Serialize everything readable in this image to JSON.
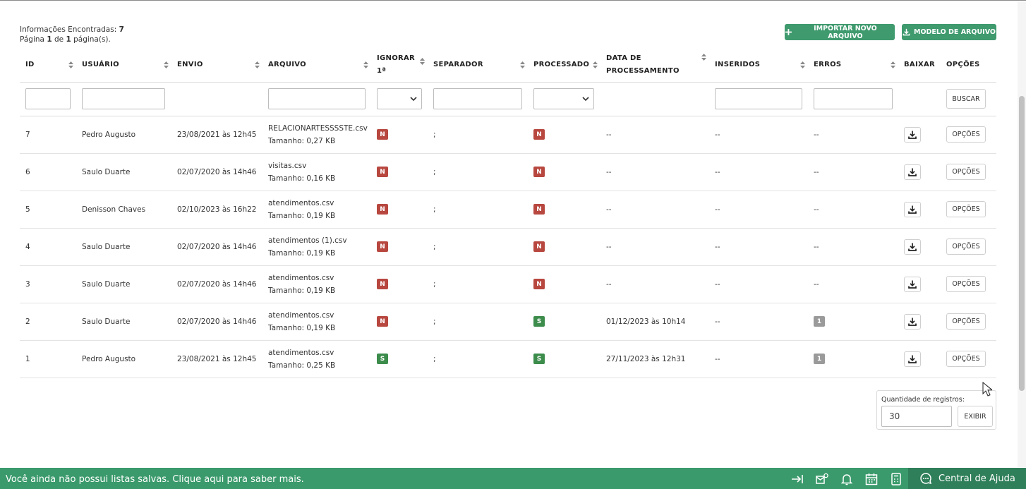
{
  "summary": {
    "found_label": "Informações Encontradas:",
    "found_count": "7",
    "page_prefix": "Página",
    "page_current": "1",
    "page_of": "de",
    "page_total": "1",
    "page_suffix": "página(s)."
  },
  "toolbar": {
    "import_label": "IMPORTAR NOVO ARQUIVO",
    "template_label": "MODELO DE ARQUIVO"
  },
  "columns": {
    "id": "ID",
    "usuario": "USUÁRIO",
    "envio": "ENVIO",
    "arquivo": "ARQUIVO",
    "ignorar_1": "IGNORAR",
    "ignorar_2": "1ª",
    "separador": "SEPARADOR",
    "processado": "PROCESSADO",
    "data_1": "DATA DE",
    "data_2": "PROCESSAMENTO",
    "inseridos": "INSERIDOS",
    "erros": "ERROS",
    "baixar": "BAIXAR",
    "opcoes": "OPÇÕES"
  },
  "filters": {
    "search_label": "BUSCAR"
  },
  "row_option_label": "OPÇÕES",
  "rows": [
    {
      "id": "7",
      "user": "Pedro Augusto",
      "sent": "23/08/2021 às 12h45",
      "file": "RELACIONARTESSSSTE.csv",
      "size": "Tamanho: 0,27 KB",
      "ignore": "N",
      "sep": ";",
      "processed": "N",
      "date": "--",
      "inserted": "--",
      "errors": "--"
    },
    {
      "id": "6",
      "user": "Saulo Duarte",
      "sent": "02/07/2020 às 14h46",
      "file": "visitas.csv",
      "size": "Tamanho: 0,16 KB",
      "ignore": "N",
      "sep": ";",
      "processed": "N",
      "date": "--",
      "inserted": "--",
      "errors": "--"
    },
    {
      "id": "5",
      "user": "Denisson Chaves",
      "sent": "02/10/2023 às 16h22",
      "file": "atendimentos.csv",
      "size": "Tamanho: 0,19 KB",
      "ignore": "N",
      "sep": ";",
      "processed": "N",
      "date": "--",
      "inserted": "--",
      "errors": "--"
    },
    {
      "id": "4",
      "user": "Saulo Duarte",
      "sent": "02/07/2020 às 14h46",
      "file": "atendimentos (1).csv",
      "size": "Tamanho: 0,19 KB",
      "ignore": "N",
      "sep": ";",
      "processed": "N",
      "date": "--",
      "inserted": "--",
      "errors": "--"
    },
    {
      "id": "3",
      "user": "Saulo Duarte",
      "sent": "02/07/2020 às 14h46",
      "file": "atendimentos.csv",
      "size": "Tamanho: 0,19 KB",
      "ignore": "N",
      "sep": ";",
      "processed": "N",
      "date": "--",
      "inserted": "--",
      "errors": "--"
    },
    {
      "id": "2",
      "user": "Saulo Duarte",
      "sent": "02/07/2020 às 14h46",
      "file": "atendimentos.csv",
      "size": "Tamanho: 0,19 KB",
      "ignore": "N",
      "sep": ";",
      "processed": "S",
      "date": "01/12/2023 às 10h14",
      "inserted": "--",
      "errors": "1"
    },
    {
      "id": "1",
      "user": "Pedro Augusto",
      "sent": "23/08/2021 às 12h45",
      "file": "atendimentos.csv",
      "size": "Tamanho: 0,25 KB",
      "ignore": "S",
      "sep": ";",
      "processed": "S",
      "date": "27/11/2023 às 12h31",
      "inserted": "--",
      "errors": "1"
    }
  ],
  "records": {
    "label": "Quantidade de registros:",
    "value": "30",
    "button": "EXIBIR"
  },
  "footer": {
    "message": "Você ainda não possui listas salvas. Clique aqui para saber mais.",
    "help_label": "Central de Ajuda"
  },
  "colors": {
    "accent": "#3f9a6e",
    "badge_no": "#b7473f",
    "badge_yes": "#3c8c4c",
    "badge_count": "#9a9a9a",
    "footer": "#3b9a6c"
  }
}
